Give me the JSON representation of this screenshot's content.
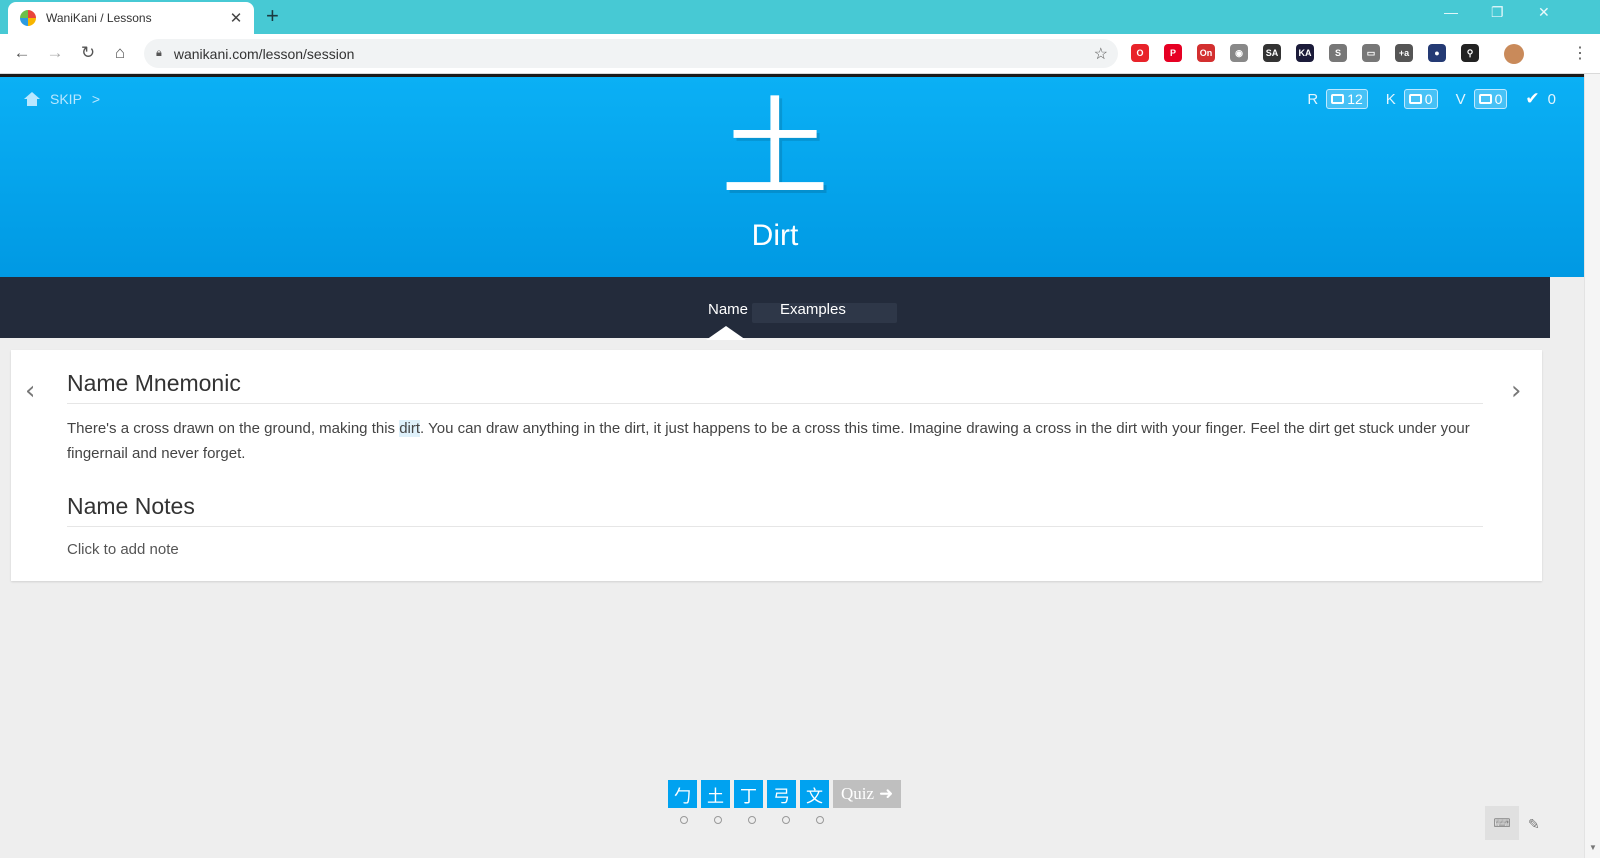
{
  "browser": {
    "tab_title": "WaniKani / Lessons",
    "tab_close": "✕",
    "new_tab": "+",
    "url": "wanikani.com/lesson/session",
    "extensions": [
      {
        "name": "opera-ext",
        "label": "O",
        "color": "#e8232a"
      },
      {
        "name": "pinterest-ext",
        "label": "P",
        "color": "#e60023"
      },
      {
        "name": "rikaikun-ext",
        "label": "On",
        "color": "#d32f2f"
      },
      {
        "name": "camera-ext",
        "label": "◉",
        "color": "#888888"
      },
      {
        "name": "sa-ext",
        "label": "SA",
        "color": "#333333"
      },
      {
        "name": "ka-ext",
        "label": "KA",
        "color": "#1b1b3a"
      },
      {
        "name": "skype-ext",
        "label": "S",
        "color": "#777777"
      },
      {
        "name": "chat-ext",
        "label": "▭",
        "color": "#777777"
      },
      {
        "name": "translate-ext",
        "label": "+a",
        "color": "#555555"
      },
      {
        "name": "ball-ext",
        "label": "●",
        "color": "#243a74"
      },
      {
        "name": "search-ext",
        "label": "⚲",
        "color": "#222222"
      }
    ]
  },
  "header": {
    "skip_label": "SKIP",
    "skip_chevron": ">",
    "counters": [
      {
        "letter": "R",
        "value": "12"
      },
      {
        "letter": "K",
        "value": "0"
      },
      {
        "letter": "V",
        "value": "0"
      }
    ],
    "done_count": "0"
  },
  "item": {
    "character": "土",
    "meaning": "Dirt"
  },
  "tabs": {
    "name": "Name",
    "examples": "Examples"
  },
  "content": {
    "mnemonic_title": "Name Mnemonic",
    "mnemonic_before": "There's a cross drawn on the ground, making this ",
    "mnemonic_highlight": "dirt",
    "mnemonic_after": ". You can draw anything in the dirt, it just happens to be a cross this time. Imagine drawing a cross in the dirt with your finger. Feel the dirt get stuck under your fingernail and never forget.",
    "notes_title": "Name Notes",
    "notes_placeholder": "Click to add note"
  },
  "queue": {
    "items": [
      "勹",
      "土",
      "丁",
      "弓",
      "文"
    ],
    "quiz_label": "Quiz",
    "quiz_arrow": "➜"
  }
}
